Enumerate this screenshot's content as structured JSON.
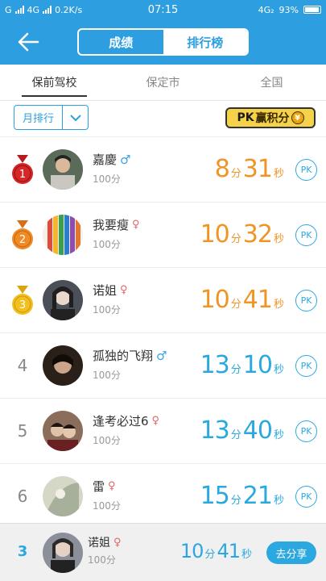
{
  "status_bar": {
    "carrier_left": "G",
    "network": "4G",
    "speed": "0.2K/s",
    "time": "07:15",
    "network_right": "4G₂",
    "battery": "93%"
  },
  "header": {
    "segments": [
      {
        "label": "成绩",
        "active": true
      },
      {
        "label": "排行榜",
        "active": false
      }
    ]
  },
  "region_tabs": [
    {
      "label": "保前驾校",
      "active": true
    },
    {
      "label": "保定市",
      "active": false
    },
    {
      "label": "全国",
      "active": false
    }
  ],
  "sort": {
    "label": "月排行"
  },
  "pk_banner": {
    "pk": "PK",
    "text": "赢积分",
    "coin": "¥"
  },
  "rows": [
    {
      "rank": "1",
      "medal": "gold-red",
      "name": "嘉慶",
      "gender": "male",
      "score": "100分",
      "min": "8",
      "min_unit": "分",
      "sec": "31",
      "sec_unit": "秒",
      "color": "orange",
      "pk": "PK"
    },
    {
      "rank": "2",
      "medal": "orange",
      "name": "我要瘦",
      "gender": "female",
      "score": "100分",
      "min": "10",
      "min_unit": "分",
      "sec": "32",
      "sec_unit": "秒",
      "color": "orange",
      "pk": "PK"
    },
    {
      "rank": "3",
      "medal": "gold",
      "name": "诺姐",
      "gender": "female",
      "score": "100分",
      "min": "10",
      "min_unit": "分",
      "sec": "41",
      "sec_unit": "秒",
      "color": "orange",
      "pk": "PK"
    },
    {
      "rank": "4",
      "medal": "",
      "name": "孤独的飞翔",
      "gender": "male",
      "score": "100分",
      "min": "13",
      "min_unit": "分",
      "sec": "10",
      "sec_unit": "秒",
      "color": "blue",
      "pk": "PK"
    },
    {
      "rank": "5",
      "medal": "",
      "name": "逢考必过6",
      "gender": "female",
      "score": "100分",
      "min": "13",
      "min_unit": "分",
      "sec": "40",
      "sec_unit": "秒",
      "color": "blue",
      "pk": "PK"
    },
    {
      "rank": "6",
      "medal": "",
      "name": "雷",
      "gender": "female",
      "score": "100分",
      "min": "15",
      "min_unit": "分",
      "sec": "21",
      "sec_unit": "秒",
      "color": "blue",
      "pk": "PK"
    }
  ],
  "my_rank": {
    "rank": "3",
    "name": "诺姐",
    "gender": "female",
    "score": "100分",
    "min": "10",
    "min_unit": "分",
    "sec": "41",
    "sec_unit": "秒",
    "share_label": "去分享"
  },
  "colors": {
    "primary": "#2d9ee0",
    "orange": "#f09426",
    "blue": "#2ba8e0"
  }
}
